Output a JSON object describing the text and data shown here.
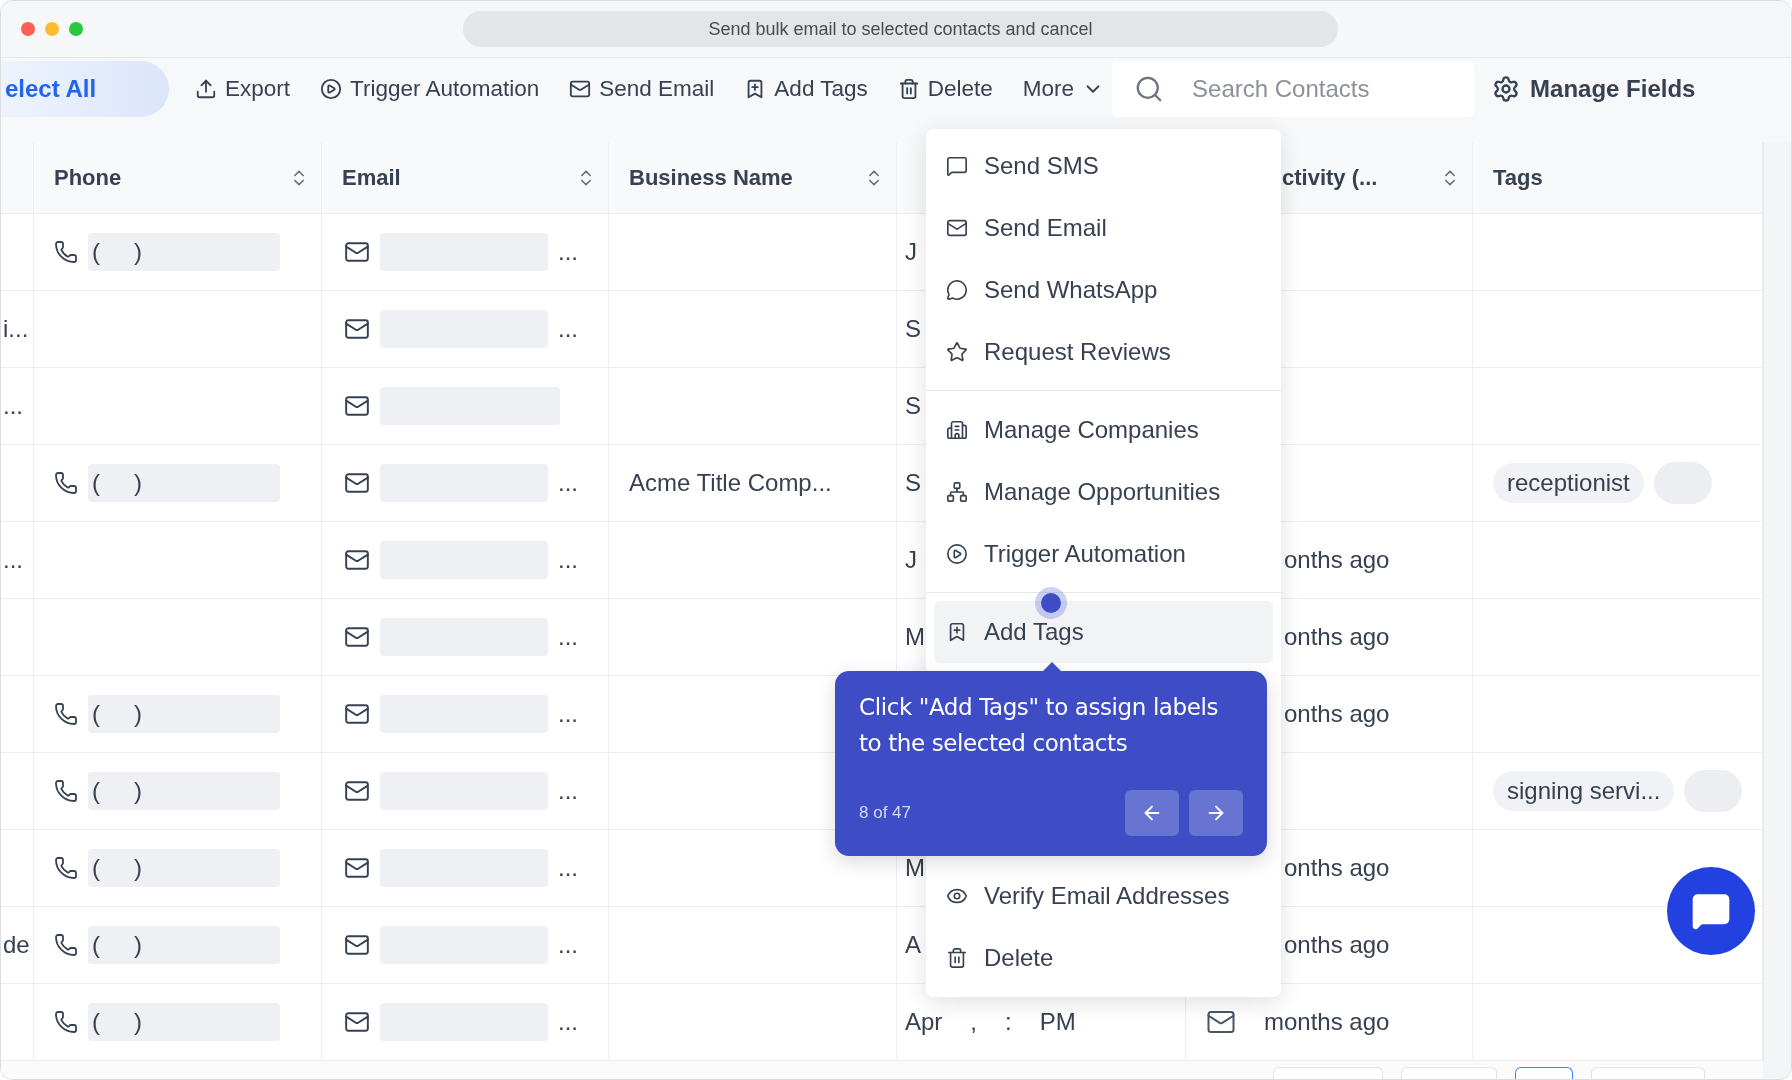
{
  "window": {
    "title": "Send bulk email to selected contacts and cancel"
  },
  "toolbar": {
    "select_all": "elect All",
    "actions": [
      "Export",
      "Trigger Automation",
      "Send Email",
      "Add Tags",
      "Delete"
    ],
    "more": "More",
    "search": {
      "placeholder": "Search Contacts"
    },
    "manage_fields": "Manage Fields"
  },
  "table": {
    "columns": [
      {
        "label": "Phone",
        "sortable": true
      },
      {
        "label": "Email",
        "sortable": true
      },
      {
        "label": "Business Name",
        "sortable": true
      },
      {
        "label": "ctivity (...",
        "sortable": true
      },
      {
        "label": "Tags",
        "sortable": false
      }
    ],
    "rows": [
      {
        "column_1": "",
        "phone": {
          "open": "(",
          "close": ")"
        },
        "email": {
          "ellipsis": "..."
        },
        "business_name": "",
        "column_4": [
          "J"
        ],
        "activity": "",
        "tags": []
      },
      {
        "column_1": "i...",
        "email": {
          "ellipsis": "..."
        },
        "business_name": "",
        "column_4": [
          "S"
        ],
        "activity": "",
        "tags": []
      },
      {
        "column_1": "...",
        "email": {},
        "business_name": "",
        "column_4": [
          "S"
        ],
        "activity": "",
        "tags": []
      },
      {
        "column_1": "",
        "phone": {
          "open": "(",
          "close": ")"
        },
        "email": {
          "ellipsis": "..."
        },
        "business_name": "Acme Title Comp...",
        "column_4": [
          "S"
        ],
        "activity": "",
        "tags": [
          "receptionist"
        ]
      },
      {
        "column_1": "...",
        "email": {
          "ellipsis": "..."
        },
        "business_name": "",
        "column_4": [
          "J"
        ],
        "activity": "onths ago",
        "activity_mail": false,
        "tags": []
      },
      {
        "column_1": "",
        "email": {
          "ellipsis": "..."
        },
        "business_name": "",
        "column_4": [
          "M"
        ],
        "activity": "onths ago",
        "activity_mail": false,
        "tags": []
      },
      {
        "column_1": "",
        "phone": {
          "open": "(",
          "close": ")"
        },
        "email": {
          "ellipsis": "..."
        },
        "business_name": "",
        "column_4": [],
        "activity": "onths ago",
        "activity_mail": false,
        "tags": []
      },
      {
        "column_1": "",
        "phone": {
          "open": "(",
          "close": ")"
        },
        "email": {
          "ellipsis": "..."
        },
        "business_name": "",
        "column_4": [],
        "activity": "",
        "tags": [
          "signing servi..."
        ]
      },
      {
        "column_1": "",
        "phone": {
          "open": "(",
          "close": ")"
        },
        "email": {
          "ellipsis": "..."
        },
        "business_name": "",
        "column_4": [
          "M"
        ],
        "activity": "onths ago",
        "activity_mail": false,
        "tags": []
      },
      {
        "column_1": "de",
        "phone": {
          "open": "(",
          "close": ")"
        },
        "email": {
          "ellipsis": "..."
        },
        "business_name": "",
        "column_4": [
          "A"
        ],
        "activity": "onths ago",
        "activity_mail": false,
        "tags": []
      },
      {
        "column_1": "",
        "phone": {
          "open": "(",
          "close": ")"
        },
        "email": {
          "ellipsis": "..."
        },
        "business_name": "",
        "column_4": [
          "Apr",
          ",",
          ":",
          "PM"
        ],
        "activity": "months ago",
        "activity_mail": true,
        "tags": []
      }
    ]
  },
  "menu": {
    "groups": [
      [
        {
          "label": "Send SMS",
          "highlighted": false
        },
        {
          "label": "Send Email",
          "highlighted": false
        },
        {
          "label": "Send WhatsApp",
          "highlighted": false
        },
        {
          "label": "Request Reviews",
          "highlighted": false
        }
      ],
      [
        {
          "label": "Manage Companies",
          "highlighted": false
        },
        {
          "label": "Manage Opportunities",
          "highlighted": false
        },
        {
          "label": "Trigger Automation",
          "highlighted": false
        }
      ],
      [
        {
          "label": "Add Tags",
          "highlighted": true
        },
        {
          "label": "Verify Email Addresses",
          "highlighted": false
        },
        {
          "label": "Delete",
          "highlighted": false
        }
      ]
    ]
  },
  "tour_tooltip": {
    "text": "Click \"Add Tags\" to assign labels to the selected contacts",
    "step": "8 of 47"
  }
}
